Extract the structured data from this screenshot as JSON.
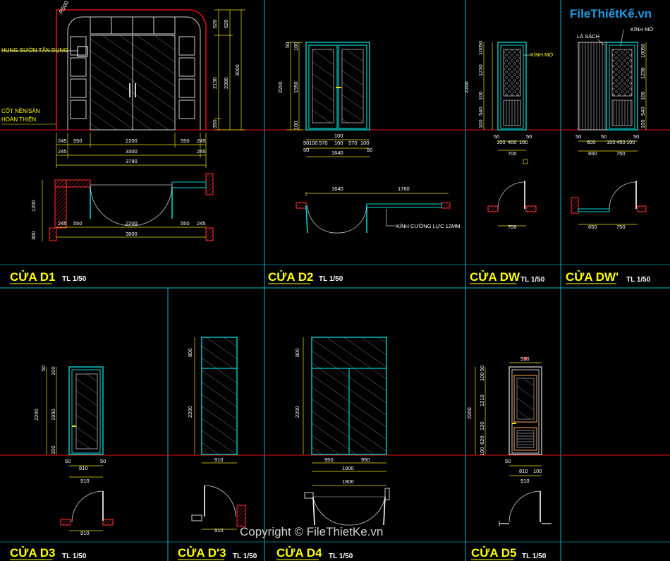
{
  "colors": {
    "background": "#000000",
    "frame": "#00b7c6",
    "floor_line": "#e01010",
    "dimension": "#f0e000",
    "door": "#00d0d0",
    "label_yellow": "#ffff00"
  },
  "logo": {
    "text": "FileThiếtKế.vn"
  },
  "copyright": "Copyright © FileThietKe.vn",
  "panels": {
    "d1": {
      "title": "CỬA D1",
      "scale": "TL 1/50",
      "annotations": {
        "radius": "R500",
        "hung_suon": "HUNG SƯỜN TẬN DỤNG",
        "cot_nen": "CỐT NỀN/SÀN",
        "hoan_thien": "HOÀN THIỆN"
      },
      "dims_right": [
        "620",
        "620",
        "2130",
        "2380",
        "3000",
        "350"
      ],
      "dims_row1": [
        "245",
        "550",
        "2200",
        "550",
        "245"
      ],
      "dims_row2": [
        "245",
        "3300",
        "245"
      ],
      "dims_row3": [
        "3790"
      ],
      "plan_left": [
        "1200",
        "300"
      ],
      "plan_row1": [
        "245",
        "550",
        "2200",
        "550",
        "245"
      ],
      "plan_row2": [
        "3800"
      ]
    },
    "d2": {
      "title": "CỬA D2",
      "scale": "TL 1/50",
      "dims_left": [
        "50",
        "100",
        "2200",
        "1950",
        "100"
      ],
      "dims_row1": [
        "100"
      ],
      "dims_row2": [
        "50",
        "100",
        "570",
        "100",
        "570",
        "100",
        "50"
      ],
      "dims_row3": [
        "1640"
      ],
      "plan_top": [
        "1640",
        "1760"
      ],
      "note": "KÍNH CƯỜNG LỰC 12MM"
    },
    "dw": {
      "title": "CỬA DW",
      "scale": "TL 1/50",
      "dims_left": [
        "50",
        "100",
        "1230",
        "2200",
        "100",
        "540",
        "100"
      ],
      "note": "KÍNH MỜ",
      "dims_row1": [
        "50",
        "100",
        "400",
        "100",
        "50"
      ],
      "dims_row2": [
        "700"
      ],
      "plan": [
        "700"
      ]
    },
    "dwp": {
      "title": "CỬA DW'",
      "scale": "TL 1/50",
      "notes": [
        "LÁ SÁCH",
        "KÍNH MỜ"
      ],
      "dims_right": [
        "50",
        "100",
        "1230",
        "100",
        "540",
        "100"
      ],
      "dims_row1": [
        "50",
        "600",
        "50",
        "100",
        "450",
        "100",
        "50"
      ],
      "dims_row2": [
        "650",
        "750"
      ],
      "plan": [
        "650",
        "750"
      ]
    },
    "d3": {
      "title": "CỬA D3",
      "scale": "TL 1/50",
      "dims_left": [
        "50",
        "100",
        "2200",
        "1950",
        "100"
      ],
      "dims_row1": [
        "50",
        "810",
        "50"
      ],
      "dims_row2": [
        "910"
      ],
      "plan": [
        "910"
      ]
    },
    "d3p": {
      "title": "CỬA D'3",
      "scale": "TL 1/50",
      "dims_left": [
        "800",
        "2200"
      ],
      "dims_row1": [
        "910"
      ],
      "plan": [
        "910"
      ]
    },
    "d4": {
      "title": "CỬA D4",
      "scale": "TL 1/50",
      "dims_left": [
        "800",
        "2200"
      ],
      "dims_row1": [
        "950",
        "950"
      ],
      "dims_row2": [
        "1900"
      ],
      "plan": [
        "1900"
      ]
    },
    "d5": {
      "title": "CỬA D5",
      "scale": "TL 1/50",
      "dims_top": [
        "910"
      ],
      "dims_left": [
        "50",
        "100",
        "1210",
        "2200",
        "120",
        "620",
        "100"
      ],
      "dims_row1": [
        "50",
        "810",
        "100"
      ],
      "dims_row2": [
        "910"
      ]
    }
  }
}
